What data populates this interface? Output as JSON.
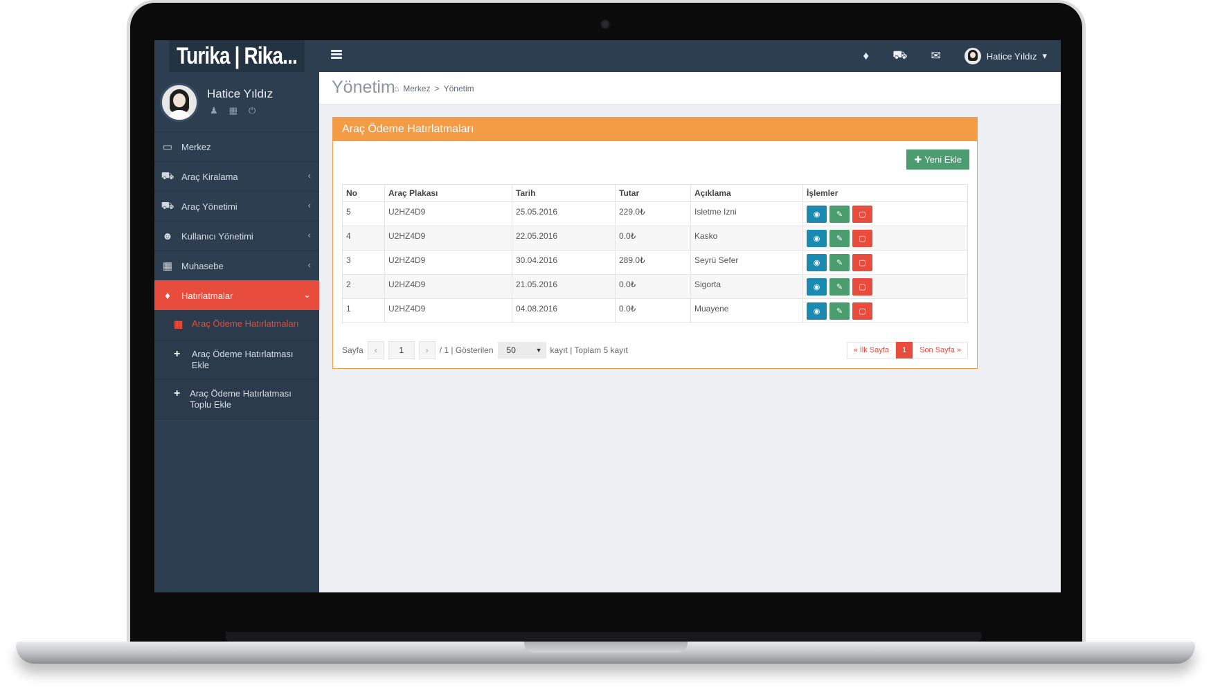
{
  "brand": "Turika | Rika...",
  "user": {
    "name": "Hatice Yıldız"
  },
  "sidebar": {
    "items": [
      {
        "label": "Merkez",
        "icon": "monitor-icon"
      },
      {
        "label": "Araç Kiralama",
        "icon": "taxi-icon"
      },
      {
        "label": "Araç Yönetimi",
        "icon": "car-icon"
      },
      {
        "label": "Kullanıcı Yönetimi",
        "icon": "users-icon"
      },
      {
        "label": "Muhasebe",
        "icon": "calculator-icon"
      },
      {
        "label": "Hatırlatmalar",
        "icon": "bell-icon"
      }
    ],
    "submenu": [
      {
        "label": "Araç Ödeme Hatırlatmaları",
        "icon": "calendar-icon"
      },
      {
        "label": "Araç Ödeme Hatırlatması Ekle",
        "icon": "plus-icon"
      },
      {
        "label": "Araç Ödeme Hatırlatması Toplu Ekle",
        "icon": "plus-icon"
      }
    ]
  },
  "header": {
    "title": "Yönetim",
    "breadcrumb": [
      "Merkez",
      "Yönetim"
    ]
  },
  "panel": {
    "title": "Araç Ödeme Hatırlatmaları",
    "add_button": "Yeni Ekle",
    "columns": [
      "No",
      "Araç Plakası",
      "Tarih",
      "Tutar",
      "Açıklama",
      "İşlemler"
    ],
    "rows": [
      {
        "no": "5",
        "plate": "U2HZ4D9",
        "date": "25.05.2016",
        "amount": "229.0₺",
        "desc": "Isletme Izni"
      },
      {
        "no": "4",
        "plate": "U2HZ4D9",
        "date": "22.05.2016",
        "amount": "0.0₺",
        "desc": "Kasko"
      },
      {
        "no": "3",
        "plate": "U2HZ4D9",
        "date": "30.04.2016",
        "amount": "289.0₺",
        "desc": "Seyrü Sefer"
      },
      {
        "no": "2",
        "plate": "U2HZ4D9",
        "date": "21.05.2016",
        "amount": "0.0₺",
        "desc": "Sigorta"
      },
      {
        "no": "1",
        "plate": "U2HZ4D9",
        "date": "04.08.2016",
        "amount": "0.0₺",
        "desc": "Muayene"
      }
    ]
  },
  "pager": {
    "label_page": "Sayfa",
    "prev": "‹",
    "next": "›",
    "page_value": "1",
    "of_text": "/ 1 | Gösterilen",
    "page_size": "50",
    "records_text": "kayıt | Toplam 5 kayıt",
    "first": "« İlk Sayfa",
    "current": "1",
    "last": "Son Sayfa »"
  },
  "colors": {
    "sidebar": "#2c3e50",
    "accent_red": "#e74c3c",
    "panel_orange": "#f39c45",
    "green": "#4b9c6e",
    "blue": "#1a8ab0"
  }
}
